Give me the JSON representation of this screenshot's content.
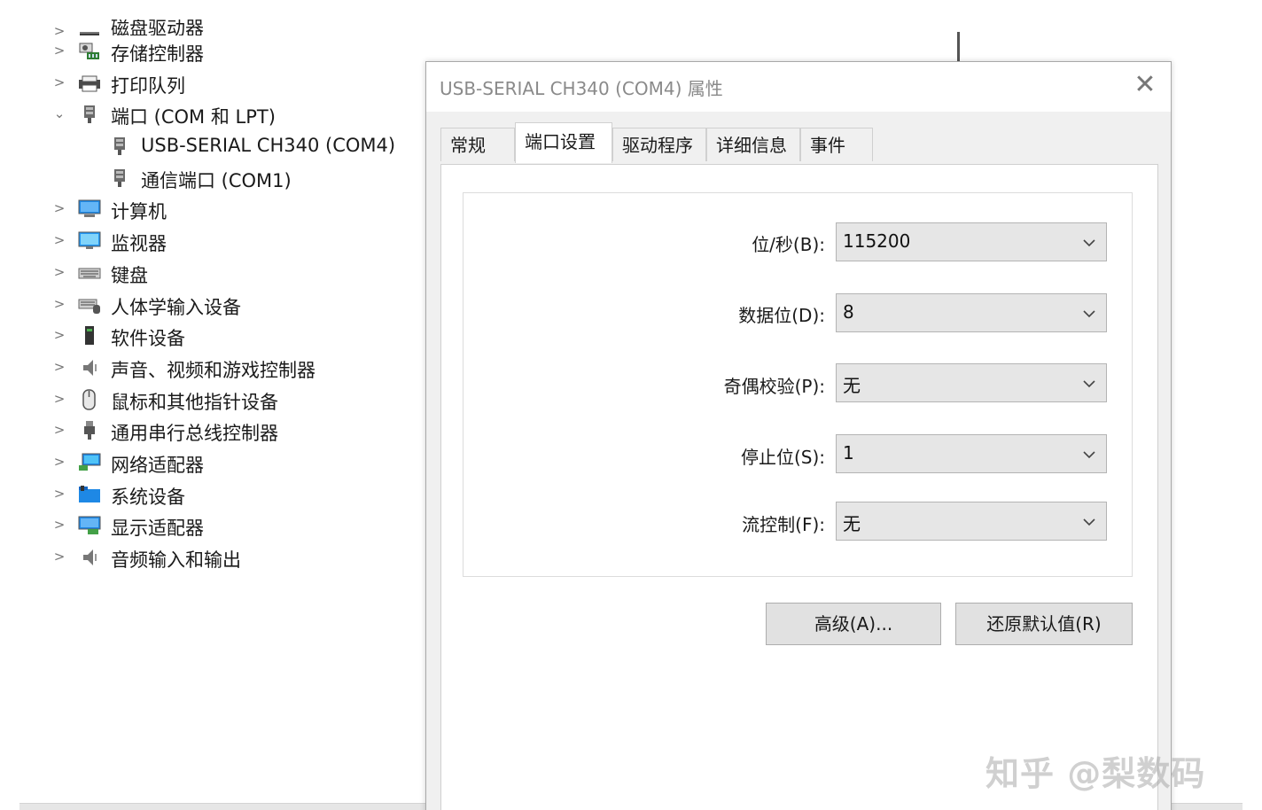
{
  "tree": {
    "items": [
      {
        "label": "磁盘驱动器",
        "icon": "disk-drive-icon",
        "expanded": false,
        "cut": true
      },
      {
        "label": "存储控制器",
        "icon": "storage-controller-icon",
        "expanded": false
      },
      {
        "label": "打印队列",
        "icon": "printer-icon",
        "expanded": false
      },
      {
        "label": "端口 (COM 和 LPT)",
        "icon": "port-icon",
        "expanded": true
      },
      {
        "label": "USB-SERIAL CH340 (COM4)",
        "icon": "port-icon",
        "child": true
      },
      {
        "label": "通信端口 (COM1)",
        "icon": "port-icon",
        "child": true
      },
      {
        "label": "计算机",
        "icon": "computer-icon",
        "expanded": false
      },
      {
        "label": "监视器",
        "icon": "monitor-icon",
        "expanded": false
      },
      {
        "label": "键盘",
        "icon": "keyboard-icon",
        "expanded": false
      },
      {
        "label": "人体学输入设备",
        "icon": "hid-icon",
        "expanded": false
      },
      {
        "label": "软件设备",
        "icon": "software-device-icon",
        "expanded": false
      },
      {
        "label": "声音、视频和游戏控制器",
        "icon": "speaker-icon",
        "expanded": false
      },
      {
        "label": "鼠标和其他指针设备",
        "icon": "mouse-icon",
        "expanded": false
      },
      {
        "label": "通用串行总线控制器",
        "icon": "usb-icon",
        "expanded": false
      },
      {
        "label": "网络适配器",
        "icon": "network-icon",
        "expanded": false
      },
      {
        "label": "系统设备",
        "icon": "system-folder-icon",
        "expanded": false
      },
      {
        "label": "显示适配器",
        "icon": "display-adapter-icon",
        "expanded": false
      },
      {
        "label": "音频输入和输出",
        "icon": "speaker-icon",
        "expanded": false
      }
    ]
  },
  "dialog": {
    "title": "USB-SERIAL CH340 (COM4) 属性",
    "close_label": "✕",
    "tabs": [
      {
        "label": "常规",
        "active": false
      },
      {
        "label": "端口设置",
        "active": true
      },
      {
        "label": "驱动程序",
        "active": false
      },
      {
        "label": "详细信息",
        "active": false
      },
      {
        "label": "事件",
        "active": false
      }
    ],
    "fields": [
      {
        "label": "位/秒(B):",
        "value": "115200"
      },
      {
        "label": "数据位(D):",
        "value": "8"
      },
      {
        "label": "奇偶校验(P):",
        "value": "无"
      },
      {
        "label": "停止位(S):",
        "value": "1"
      },
      {
        "label": "流控制(F):",
        "value": "无"
      }
    ],
    "buttons": {
      "advanced": "高级(A)...",
      "restore_defaults": "还原默认值(R)"
    }
  },
  "watermark": "知乎 @梨数码"
}
